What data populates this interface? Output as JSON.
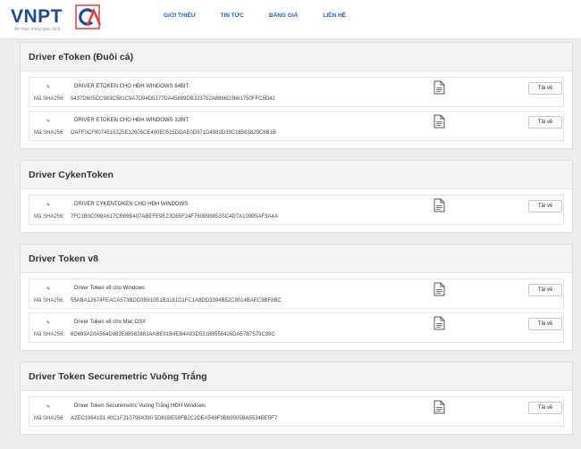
{
  "brand": {
    "name": "VNPT",
    "tagline": "An toàn trong giao dịch",
    "primary_color": "#1b4a9a",
    "accent_color": "#e43d3d"
  },
  "nav": [
    {
      "label": "GIỚI THIỆU"
    },
    {
      "label": "TIN TỨC"
    },
    {
      "label": "BẢNG GIÁ"
    },
    {
      "label": "LIÊN HỆ"
    }
  ],
  "common": {
    "hash_label": "Mã SHA256:",
    "download_label": "Tải về",
    "bullet_icon": "pencil-icon",
    "file_icon": "document-icon"
  },
  "sections": [
    {
      "title": "Driver eToken (Đuôi cá)",
      "items": [
        {
          "name": "DRIVER ETOKEN CHO HĐH WINDOWS 64BIT",
          "hash": "0437D605CC983C581C9A7D94D5377DA45899DB323752A8866D3661750FFC5D42"
        },
        {
          "name": "DRIVER ETOKEN CHO HĐH WINDOWS 32BIT",
          "hash": "DAFF3CF8074515225E12605CE400E0515DDAE0D971D4882D39C18563829C8B1B"
        }
      ]
    },
    {
      "title": "Driver CykenToken",
      "items": [
        {
          "name": "DRIVER CYKENTOKEN CHO HĐH WINDOWS",
          "hash": "7FC1B0C098A617CB69B407ABEFE9E23D65F24F760B99853SC4D7A109B5AF3A4A"
        }
      ]
    },
    {
      "title": "Driver Token v8",
      "items": [
        {
          "name": "Driver Token v8 cho Windows",
          "hash": "55ABA12674FEACA573BDC0B910E1B3181D1FC1A8DD3394B52C9014BAEC9BF8BC"
        },
        {
          "name": "Driver Token v8 cho Mac OSX",
          "hash": "6D693A20A564D983E88562883AABE91B4EB4A93D5318B558426DA57B7579C89C"
        }
      ]
    },
    {
      "title": "Driver Token Securemetric Vuông Trắng",
      "items": [
        {
          "name": "Driver Token Securemetric Vuông Trắng HĐH Windows",
          "hash": "A2EC1964191 40C1F2107984390 5D81BE58FB2C2DEA548F9B69905BA5534BE5F7"
        }
      ]
    }
  ]
}
